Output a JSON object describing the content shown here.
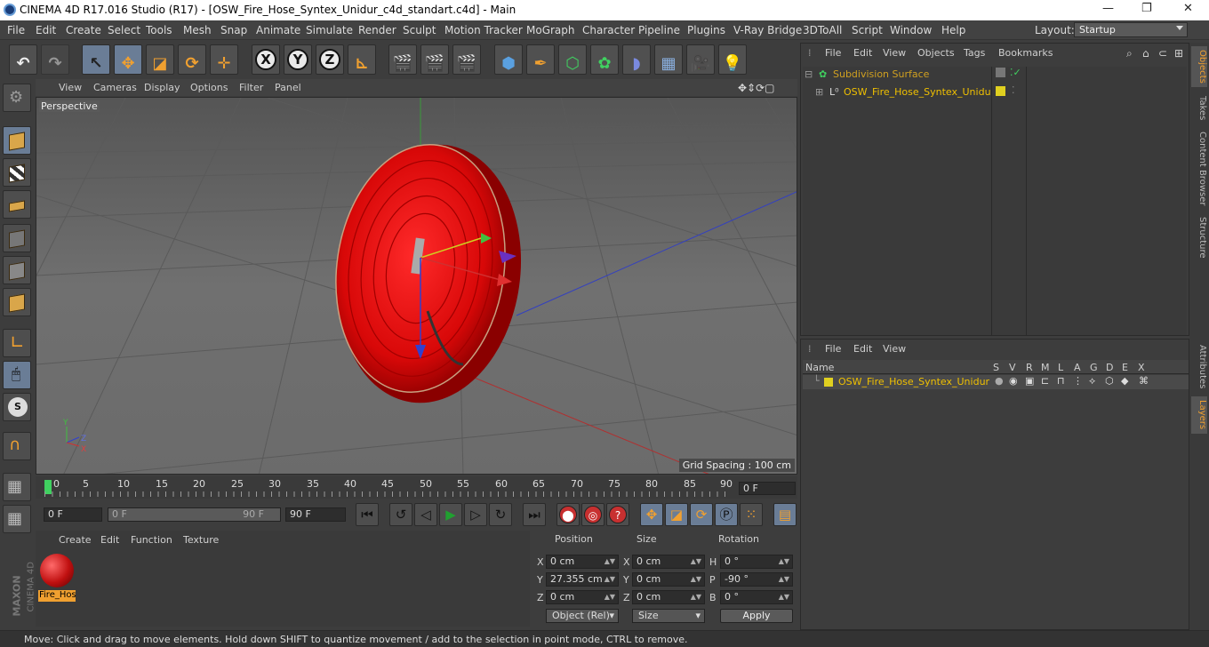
{
  "window": {
    "title": "CINEMA 4D R17.016 Studio (R17) - [OSW_Fire_Hose_Syntex_Unidur_c4d_standart.c4d] - Main",
    "min": "—",
    "max": "❐",
    "close": "✕"
  },
  "menu": {
    "items": [
      "File",
      "Edit",
      "Create",
      "Select",
      "Tools",
      "Mesh",
      "Snap",
      "Animate",
      "Simulate",
      "Render",
      "Sculpt",
      "Motion Tracker",
      "MoGraph",
      "Character",
      "Pipeline",
      "Plugins",
      "V-Ray Bridge",
      "3DToAll",
      "Script",
      "Window",
      "Help"
    ],
    "layout_label": "Layout:",
    "layout_value": "Startup"
  },
  "toolbar": {
    "axis_x": "X",
    "axis_y": "Y",
    "axis_z": "Z"
  },
  "viewport": {
    "menu": [
      "View",
      "Cameras",
      "Display",
      "Options",
      "Filter",
      "Panel"
    ],
    "camera_label": "Perspective",
    "grid_spacing": "Grid Spacing : 100 cm",
    "axis_labels": {
      "y": "Y",
      "z": "Z",
      "x": "X"
    },
    "object_color": "#d81010"
  },
  "timeline": {
    "ticks": [
      "0",
      "5",
      "10",
      "15",
      "20",
      "25",
      "30",
      "35",
      "40",
      "45",
      "50",
      "55",
      "60",
      "65",
      "70",
      "75",
      "80",
      "85",
      "90"
    ],
    "frame_display": "0 F",
    "start_frame": "0 F",
    "slider_left": "0 F",
    "slider_right": "90 F",
    "end_frame": "90 F"
  },
  "material_panel": {
    "menu": [
      "Create",
      "Edit",
      "Function",
      "Texture"
    ],
    "material_name": "Fire_Hos"
  },
  "coords": {
    "headers": [
      "Position",
      "Size",
      "Rotation"
    ],
    "rows": [
      {
        "pl": "X",
        "pv": "0 cm",
        "sl": "X",
        "sv": "0 cm",
        "rl": "H",
        "rv": "0 °"
      },
      {
        "pl": "Y",
        "pv": "27.355 cm",
        "sl": "Y",
        "sv": "0 cm",
        "rl": "P",
        "rv": "-90 °"
      },
      {
        "pl": "Z",
        "pv": "0 cm",
        "sl": "Z",
        "sv": "0 cm",
        "rl": "B",
        "rv": "0 °"
      }
    ],
    "mode_dropdown": "Object (Rel)",
    "size_dropdown": "Size",
    "apply": "Apply"
  },
  "objects_panel": {
    "menu": [
      "File",
      "Edit",
      "View",
      "Objects",
      "Tags",
      "Bookmarks"
    ],
    "items": [
      {
        "name": "Subdivision Surface",
        "color": "#d0a020"
      },
      {
        "name": "OSW_Fire_Hose_Syntex_Unidur",
        "color": "#f0c000"
      }
    ]
  },
  "layers_panel": {
    "menu": [
      "File",
      "Edit",
      "View"
    ],
    "columns": [
      "Name",
      "S",
      "V",
      "R",
      "M",
      "L",
      "A",
      "G",
      "D",
      "E",
      "X"
    ],
    "row_name": "OSW_Fire_Hose_Syntex_Unidur"
  },
  "side_tabs": [
    "Objects",
    "Takes",
    "Content Browser",
    "Structure",
    "Attributes",
    "Layers"
  ],
  "branding": {
    "brand1": "MAXON",
    "brand2": "CINEMA 4D"
  },
  "status": "Move: Click and drag to move elements. Hold down SHIFT to quantize movement / add to the selection in point mode, CTRL to remove."
}
